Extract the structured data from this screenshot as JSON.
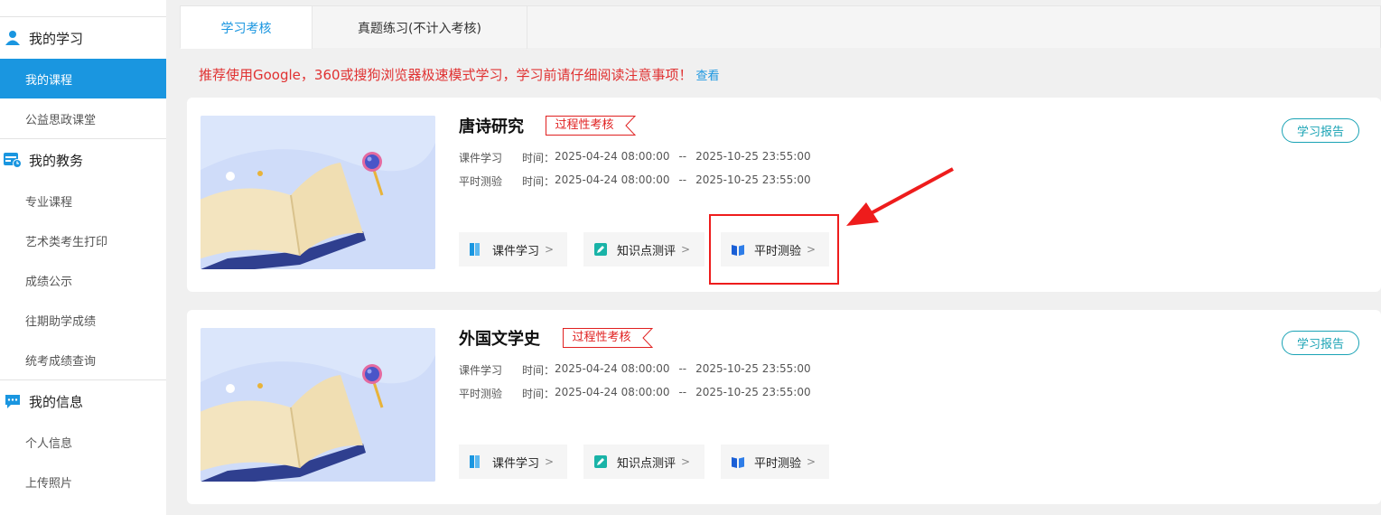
{
  "sidebar": {
    "group1": {
      "icon": "user-icon",
      "label": "我的学习",
      "items": [
        "我的课程",
        "公益思政课堂"
      ]
    },
    "group2": {
      "icon": "calendar-clock-icon",
      "label": "我的教务",
      "items": [
        "专业课程",
        "艺术类考生打印",
        "成绩公示",
        "往期助学成绩",
        "统考成绩查询"
      ]
    },
    "group3": {
      "icon": "chat-icon",
      "label": "我的信息",
      "items": [
        "个人信息",
        "上传照片"
      ]
    },
    "active_item": "我的课程",
    "accent": "#1a96e0"
  },
  "tabs": [
    "学习考核",
    "真题练习(不计入考核)"
  ],
  "notice": {
    "text": "推荐使用Google，360或搜狗浏览器极速模式学习，学习前请仔细阅读注意事项！",
    "link": "查看"
  },
  "courses": [
    {
      "title": "唐诗研究",
      "tag": "过程性考核",
      "rows": [
        {
          "label": "课件学习",
          "time_prefix": "时间：",
          "start": "2025-04-24 08:00:00",
          "sep": "--",
          "end": "2025-10-25 23:55:00"
        },
        {
          "label": "平时测验",
          "time_prefix": "时间：",
          "start": "2025-04-24 08:00:00",
          "sep": "--",
          "end": "2025-10-25 23:55:00"
        }
      ],
      "report_label": "学习报告",
      "actions": [
        {
          "label": "课件学习",
          "icon": "book-icon"
        },
        {
          "label": "知识点测评",
          "icon": "edit-icon"
        },
        {
          "label": "平时测验",
          "icon": "open-book-icon"
        }
      ]
    },
    {
      "title": "外国文学史",
      "tag": "过程性考核",
      "rows": [
        {
          "label": "课件学习",
          "time_prefix": "时间：",
          "start": "2025-04-24 08:00:00",
          "sep": "--",
          "end": "2025-10-25 23:55:00"
        },
        {
          "label": "平时测验",
          "time_prefix": "时间：",
          "start": "2025-04-24 08:00:00",
          "sep": "--",
          "end": "2025-10-25 23:55:00"
        }
      ],
      "report_label": "学习报告",
      "actions": [
        {
          "label": "课件学习",
          "icon": "book-icon"
        },
        {
          "label": "知识点测评",
          "icon": "edit-icon"
        },
        {
          "label": "平时测验",
          "icon": "open-book-icon"
        }
      ]
    }
  ],
  "colors": {
    "tag": "#e02020",
    "report": "#1aa3b5",
    "annotation": "#ee1c1c",
    "thumb_bg": "#dbe6fb"
  }
}
